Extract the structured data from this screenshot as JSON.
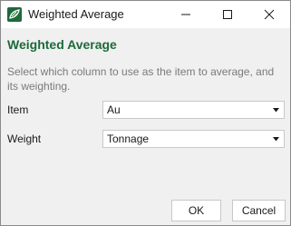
{
  "window": {
    "title": "Weighted Average",
    "icon": "app-leaf-icon",
    "controls": [
      "minimize-icon",
      "maximize-icon",
      "close-icon"
    ]
  },
  "dialog": {
    "heading": "Weighted Average",
    "description": "Select which column to use as the item to average, and its weighting.",
    "fields": {
      "item": {
        "label": "Item",
        "value": "Au"
      },
      "weight": {
        "label": "Weight",
        "value": "Tonnage"
      }
    },
    "buttons": {
      "ok": "OK",
      "cancel": "Cancel"
    }
  },
  "colors": {
    "accent": "#1d6a3a",
    "description_text": "#7a7a7a",
    "dialog_background": "#f0f0f0"
  }
}
